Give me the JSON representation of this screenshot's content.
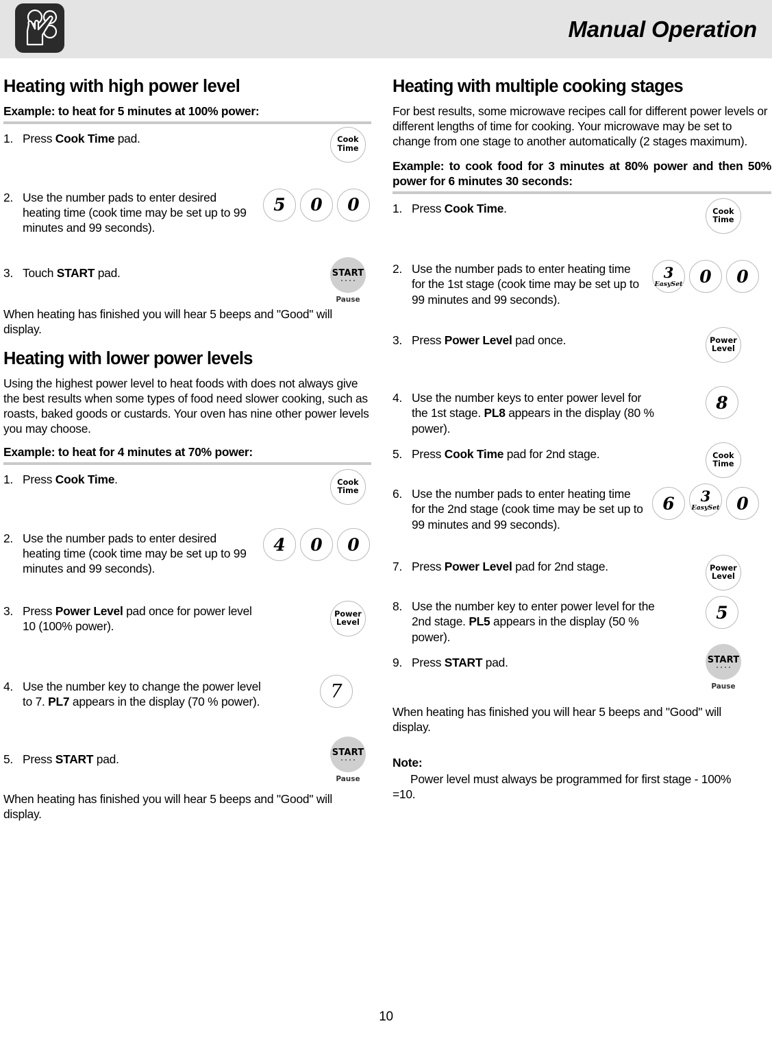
{
  "header": {
    "title": "Manual Operation",
    "icon": "hand-pressing-keypad-icon"
  },
  "page_number": "10",
  "left_column": {
    "section1": {
      "heading": "Heating with high power level",
      "example": "Example: to heat for 5 minutes at 100% power:",
      "steps": [
        {
          "num": "1.",
          "text_before": "Press ",
          "bold": "Cook Time",
          "text_after": " pad."
        },
        {
          "num": "2.",
          "text_before": "Use the number pads to enter desired heating time (cook time may be set up to 99 minutes and 99 seconds).",
          "bold": "",
          "text_after": ""
        },
        {
          "num": "3.",
          "text_before": "Touch ",
          "bold": "START",
          "text_after": " pad."
        }
      ],
      "closing": "When heating has finished you will hear 5 beeps and \"Good\" will display."
    },
    "section2": {
      "heading": "Heating with lower power levels",
      "intro": "Using the highest power level to heat foods with does not always give the best results when some types of food need slower cooking, such as roasts, baked goods or custards. Your oven has nine other power levels you may choose.",
      "example": "Example: to heat for 4 minutes at 70% power:",
      "steps": [
        {
          "num": "1.",
          "text_before": "Press ",
          "bold": "Cook Time",
          "text_after": "."
        },
        {
          "num": "2.",
          "text_before": "Use the number pads to enter desired heating time (cook time may be set up to 99 minutes and 99 seconds).",
          "bold": "",
          "text_after": ""
        },
        {
          "num": "3.",
          "text_before": "Press ",
          "bold": "Power Level",
          "text_after": " pad once for power level 10 (100% power)."
        },
        {
          "num": "4.",
          "text_before": "Use the number key to change the power level to 7. ",
          "bold": "PL7",
          "text_after": " appears in the display (70 % power)."
        },
        {
          "num": "5.",
          "text_before": "Press ",
          "bold": "START",
          "text_after": " pad."
        }
      ],
      "closing": "When heating has finished you will hear 5 beeps and \"Good\" will display."
    },
    "pads": {
      "cook_time": {
        "line1": "Cook",
        "line2": "Time"
      },
      "power_level": {
        "line1": "Power",
        "line2": "Level"
      },
      "start": {
        "label": "START",
        "sublabel": "Pause"
      },
      "time_100": [
        "5",
        "0",
        "0"
      ],
      "time_70": [
        "4",
        "0",
        "0"
      ],
      "power_digit_7": "7"
    }
  },
  "right_column": {
    "heading": "Heating with multiple cooking stages",
    "intro": "For best results, some microwave recipes call for different power levels or different lengths of time for cooking. Your microwave may be set to change from one stage to another automatically (2 stages maximum).",
    "example": "Example: to cook food for 3 minutes at 80% power and then 50% power for 6 minutes 30 seconds:",
    "steps": [
      {
        "num": "1.",
        "text_before": "Press ",
        "bold": "Cook Time",
        "text_after": "."
      },
      {
        "num": "2.",
        "text_before": "Use the number pads to enter heating time for the 1st stage (cook time may be set up to 99 minutes and 99 seconds).",
        "bold": "",
        "text_after": ""
      },
      {
        "num": "3.",
        "text_before": "Press ",
        "bold": "Power Level",
        "text_after": " pad once."
      },
      {
        "num": "4.",
        "text_before": "Use the number keys to enter power level for the 1st stage. ",
        "bold": "PL8",
        "text_after": " appears in the display (80 % power)."
      },
      {
        "num": "5.",
        "text_before": "Press ",
        "bold": "Cook Time",
        "text_after": " pad for 2nd stage."
      },
      {
        "num": "6.",
        "text_before": "Use the number pads to enter heating time for the 2nd stage (cook time may be set up to 99 minutes and 99 seconds).",
        "bold": "",
        "text_after": ""
      },
      {
        "num": "7.",
        "text_before": "Press ",
        "bold": "Power Level",
        "text_after": " pad for 2nd stage."
      },
      {
        "num": "8.",
        "text_before": "Use the number key to enter power level for the 2nd stage. ",
        "bold": "PL5",
        "text_after": " appears in the display (50 % power)."
      },
      {
        "num": "9.",
        "text_before": "Press ",
        "bold": "START",
        "text_after": " pad."
      }
    ],
    "closing": "When heating has finished you will hear 5 beeps and \"Good\" will display.",
    "note_title": "Note:",
    "note_body": "Power level must always be programmed for first stage - 100% =10.",
    "pads": {
      "cook_time": {
        "line1": "Cook",
        "line2": "Time"
      },
      "power_level": {
        "line1": "Power",
        "line2": "Level"
      },
      "start": {
        "label": "START",
        "sublabel": "Pause"
      },
      "easyset_label": "EasySet",
      "stage1_time": [
        "3",
        "0",
        "0"
      ],
      "stage1_power": "8",
      "stage2_time": [
        "6",
        "3",
        "0"
      ],
      "stage2_power": "5"
    }
  },
  "colors": {
    "header_bg": "#e4e4e4",
    "icon_bg": "#2b2b2b",
    "rule": "#c9c9c9",
    "pad_outline": "#b9b9b9",
    "start_fill": "#cfcfcf"
  }
}
